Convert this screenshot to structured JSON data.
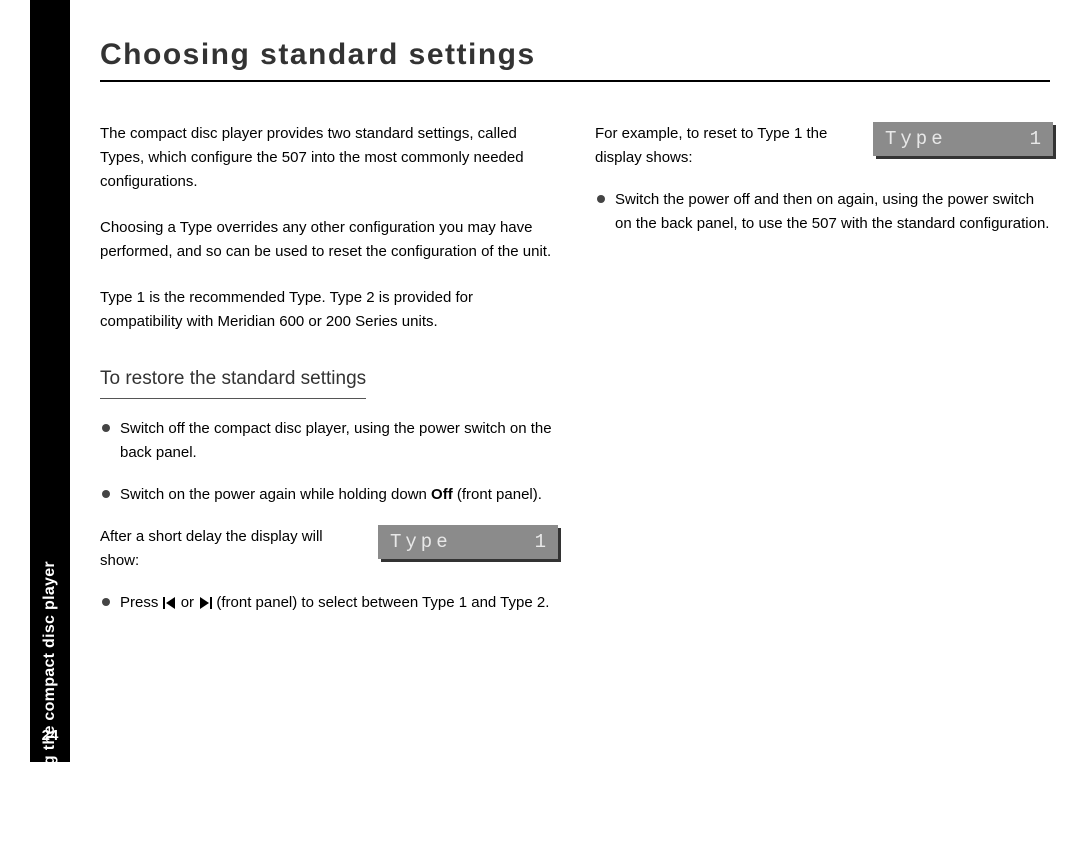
{
  "sidebar": {
    "page_number": "24",
    "section_title": "Configuring the compact disc player"
  },
  "heading": "Choosing standard settings",
  "left_column": {
    "p1": "The compact disc player provides two standard settings, called Types, which configure the 507 into the most commonly needed configurations.",
    "p2": "Choosing a Type overrides any other configuration you may have performed, and so can be used to reset the configuration of the unit.",
    "p3": "Type 1 is the recommended Type. Type 2 is provided for compatibility with Meridian 600 or 200 Series units.",
    "subheading": "To restore the standard settings",
    "bullets_a": [
      "Switch off the compact disc player, using the power switch on the back panel.",
      "Switch on the power again while holding down Off (front panel)."
    ],
    "after_delay": "After a short delay the display will show:",
    "display1": {
      "label": "Type",
      "value": "1"
    },
    "press_before": "Press ",
    "press_mid": " or ",
    "press_after": " (front panel) to select between Type 1 and Type 2."
  },
  "right_column": {
    "example_text": "For example, to reset to Type 1 the display shows:",
    "display2": {
      "label": "Type",
      "value": "1"
    },
    "bullet": "Switch the power off and then on again, using the power switch on the back panel, to use the 507 with the standard configuration."
  }
}
